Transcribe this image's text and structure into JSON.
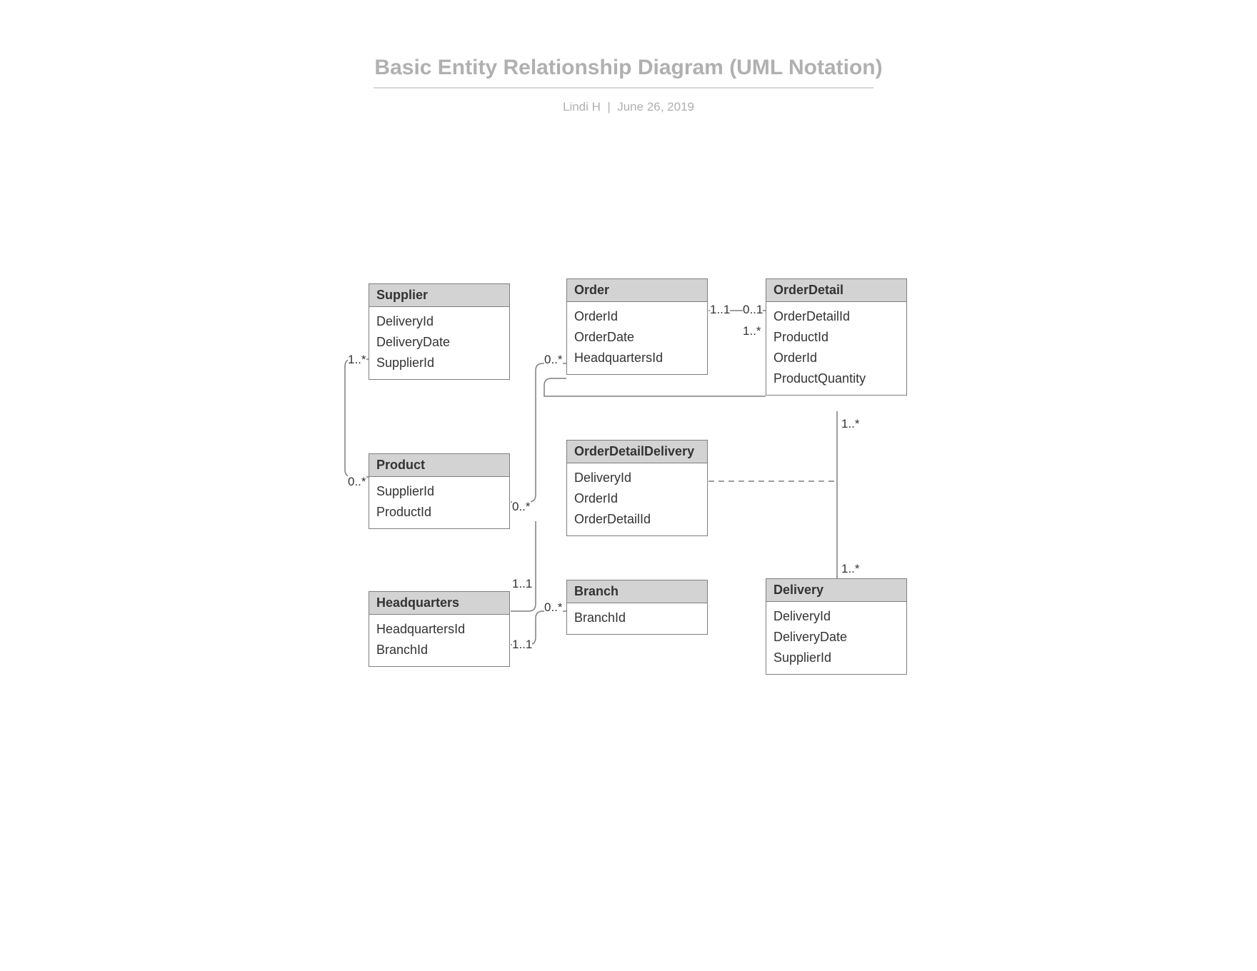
{
  "title": "Basic Entity Relationship Diagram (UML Notation)",
  "byline": "Lindi H  |  June 26, 2019",
  "entities": {
    "supplier": {
      "name": "Supplier",
      "attrs": [
        "DeliveryId",
        "DeliveryDate",
        "SupplierId"
      ]
    },
    "product": {
      "name": "Product",
      "attrs": [
        "SupplierId",
        "ProductId"
      ]
    },
    "headquarters": {
      "name": "Headquarters",
      "attrs": [
        "HeadquartersId",
        "BranchId"
      ]
    },
    "order": {
      "name": "Order",
      "attrs": [
        "OrderId",
        "OrderDate",
        "HeadquartersId"
      ]
    },
    "orderDetailDelivery": {
      "name": "OrderDetailDelivery",
      "attrs": [
        "DeliveryId",
        "OrderId",
        "OrderDetailId"
      ]
    },
    "branch": {
      "name": "Branch",
      "attrs": [
        "BranchId"
      ]
    },
    "orderDetail": {
      "name": "OrderDetail",
      "attrs": [
        "OrderDetailId",
        "ProductId",
        "OrderId",
        "ProductQuantity"
      ]
    },
    "delivery": {
      "name": "Delivery",
      "attrs": [
        "DeliveryId",
        "DeliveryDate",
        "SupplierId"
      ]
    }
  },
  "mult": {
    "supplier_side": "1..*",
    "product_side": "0..*",
    "order_left_zero": "0..*",
    "product_right_zero": "0..*",
    "hq_top": "1..1",
    "hq_bottom": "1..1",
    "branch_top": "0..*",
    "order_right": "1..1",
    "orderdetail_left": "0..1",
    "orderdetail_bottom1": "1..*",
    "orderdetail_delivery_mid": "1..*",
    "delivery_top": "1..*"
  }
}
